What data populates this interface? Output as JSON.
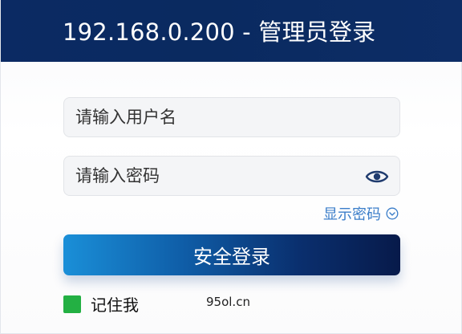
{
  "header": {
    "title": "192.168.0.200 - 管理员登录"
  },
  "form": {
    "username_placeholder": "请输入用户名",
    "password_placeholder": "请输入密码",
    "show_password_label": "显示密码",
    "submit_label": "安全登录",
    "remember_label": "记住我",
    "remember_checked": true
  },
  "watermark": "95ol.cn",
  "icons": {
    "password_toggle": "eye-icon",
    "show_password": "chevron-circle-icon"
  },
  "colors": {
    "header_bg": "#0b2a63",
    "link": "#3a7dc9",
    "button_start": "#1a8fd8",
    "button_end": "#071a4a",
    "checkbox": "#23b043"
  }
}
